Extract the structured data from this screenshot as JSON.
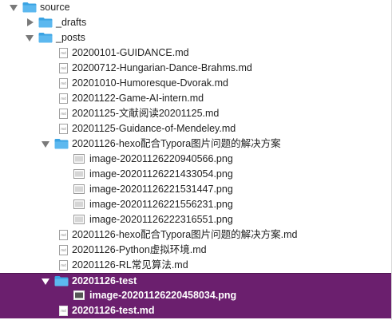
{
  "tree": {
    "items": [
      {
        "label": "source",
        "type": "folder",
        "expanded": true
      },
      {
        "label": "_drafts",
        "type": "folder",
        "expanded": false
      },
      {
        "label": "_posts",
        "type": "folder",
        "expanded": true
      },
      {
        "label": "20200101-GUIDANCE.md",
        "type": "md"
      },
      {
        "label": "20200712-Hungarian-Dance-Brahms.md",
        "type": "md"
      },
      {
        "label": "20201010-Humoresque-Dvorak.md",
        "type": "md"
      },
      {
        "label": "20201122-Game-AI-intern.md",
        "type": "md"
      },
      {
        "label": "20201125-文献阅读20201125.md",
        "type": "md"
      },
      {
        "label": "20201125-Guidance-of-Mendeley.md",
        "type": "md"
      },
      {
        "label": "20201126-hexo配合Typora图片问题的解决方案",
        "type": "folder",
        "expanded": true
      },
      {
        "label": "image-20201126220940566.png",
        "type": "png"
      },
      {
        "label": "image-20201126221433054.png",
        "type": "png"
      },
      {
        "label": "image-20201126221531447.png",
        "type": "png"
      },
      {
        "label": "image-20201126221556231.png",
        "type": "png"
      },
      {
        "label": "image-20201126222316551.png",
        "type": "png"
      },
      {
        "label": "20201126-hexo配合Typora图片问题的解决方案.md",
        "type": "md"
      },
      {
        "label": "20201126-Python虚拟环境.md",
        "type": "md"
      },
      {
        "label": "20201126-RL常见算法.md",
        "type": "md"
      },
      {
        "label": "20201126-test",
        "type": "folder",
        "expanded": true,
        "selected": true
      },
      {
        "label": "image-20201126220458034.png",
        "type": "png",
        "selected": true
      },
      {
        "label": "20201126-test.md",
        "type": "md",
        "selected": true
      }
    ]
  },
  "colors": {
    "selection": "#6b1f6e",
    "folder": "#3aa3e3",
    "disclosure": "#7a7a7a"
  }
}
